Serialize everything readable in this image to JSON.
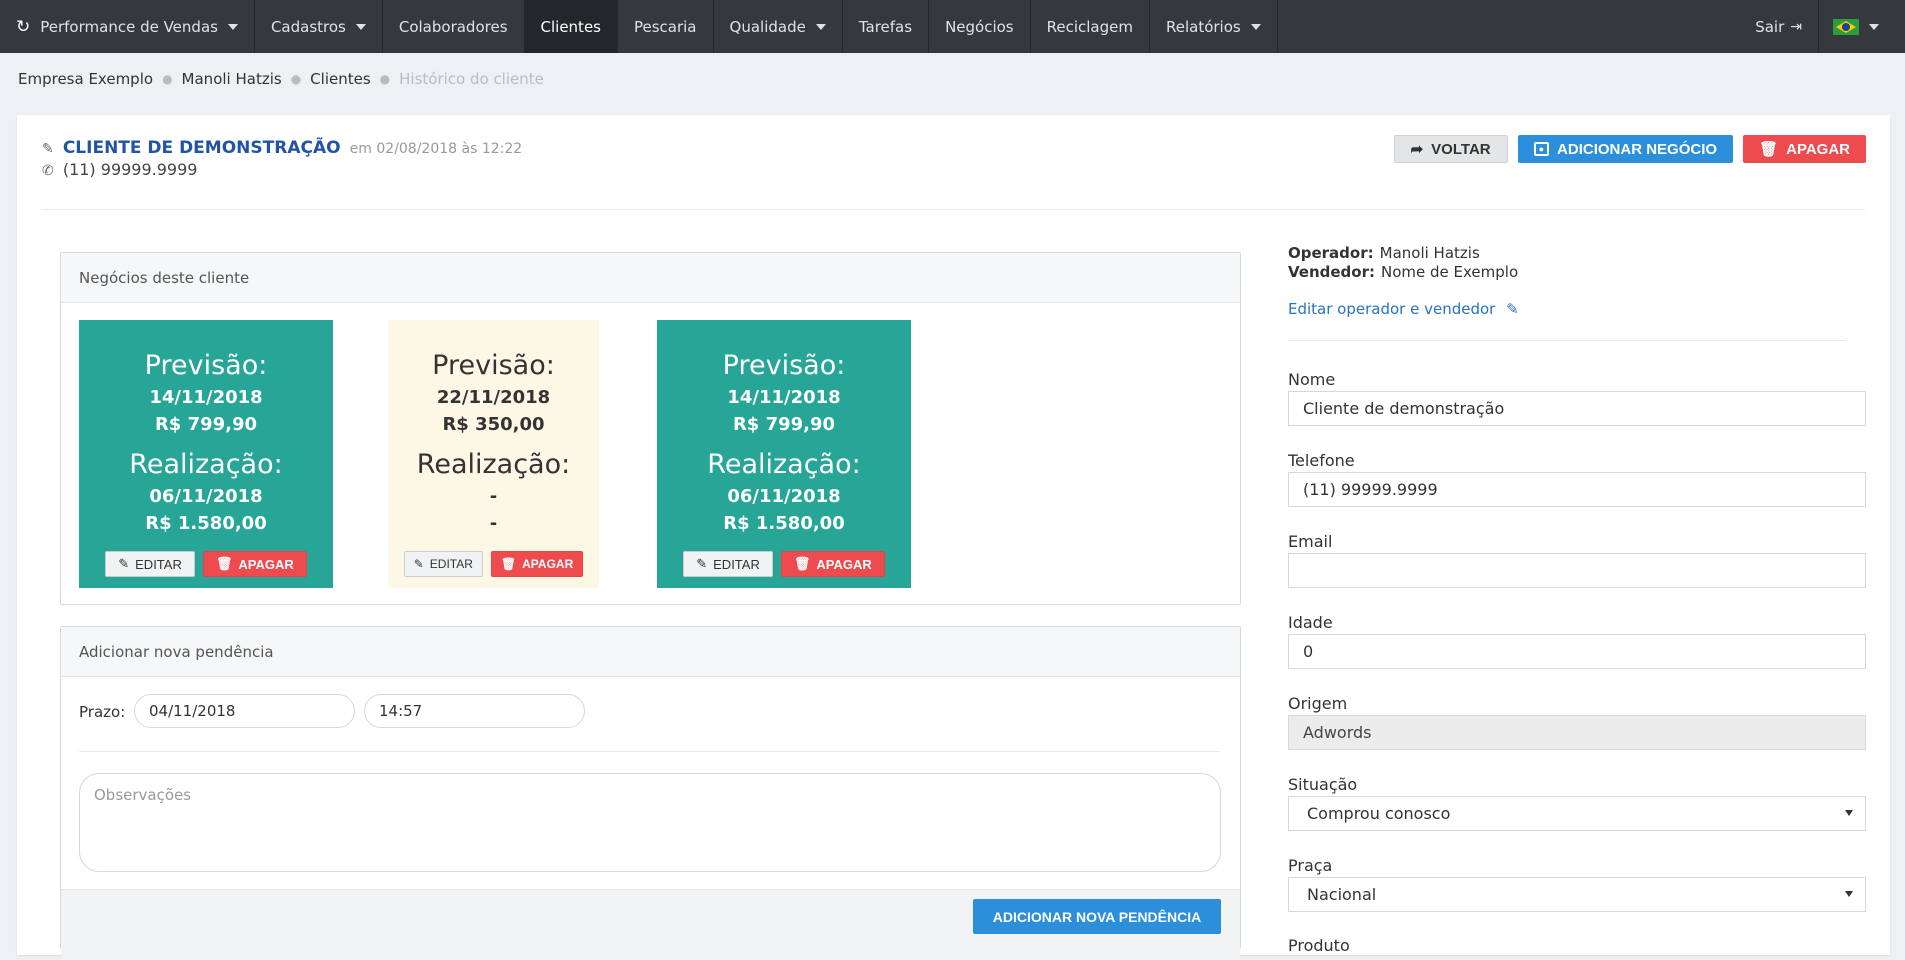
{
  "navbar": {
    "brand": "Performance de Vendas",
    "items": [
      "Cadastros",
      "Colaboradores",
      "Clientes",
      "Pescaria",
      "Qualidade",
      "Tarefas",
      "Negócios",
      "Reciclagem",
      "Relatórios"
    ],
    "active": "Clientes",
    "logout": "Sair"
  },
  "breadcrumb": [
    "Empresa Exemplo",
    "Manoli Hatzis",
    "Clientes",
    "Histórico do cliente"
  ],
  "client": {
    "title": "CLIENTE DE DEMONSTRAÇÃO",
    "date": "em 02/08/2018 às 12:22",
    "phone": "(11) 99999.9999"
  },
  "actions": {
    "back": "VOLTAR",
    "add_deal": "ADICIONAR NEGÓCIO",
    "delete": "APAGAR"
  },
  "deals_panel": {
    "title": "Negócios deste cliente",
    "forecast_label": "Previsão:",
    "done_label": "Realização:",
    "edit_label": "EDITAR",
    "delete_label": "APAGAR",
    "deals": [
      {
        "forecast_date": "14/11/2018",
        "forecast_value": "R$ 799,90",
        "done_date": "06/11/2018",
        "done_value": "R$ 1.580,00",
        "status_color": "#27a596"
      },
      {
        "forecast_date": "22/11/2018",
        "forecast_value": "R$ 350,00",
        "done_date": "-",
        "done_value": "-",
        "status_color": "#fdf8e6"
      },
      {
        "forecast_date": "14/11/2018",
        "forecast_value": "R$ 799,90",
        "done_date": "06/11/2018",
        "done_value": "R$ 1.580,00",
        "status_color": "#27a596"
      }
    ]
  },
  "pending_panel": {
    "title": "Adicionar nova pendência",
    "deadline_label": "Prazo:",
    "date": "04/11/2018",
    "time": "14:57",
    "notes_placeholder": "Observações",
    "submit": "ADICIONAR NOVA PENDÊNCIA"
  },
  "sidebar": {
    "operator_label": "Operador:",
    "operator": "Manoli Hatzis",
    "seller_label": "Vendedor:",
    "seller": "Nome de Exemplo",
    "edit_link": "Editar operador e vendedor",
    "fields": {
      "name_label": "Nome",
      "name": "Cliente de demonstração",
      "phone_label": "Telefone",
      "phone": "(11) 99999.9999",
      "email_label": "Email",
      "email": "",
      "age_label": "Idade",
      "age": "0",
      "origin_label": "Origem",
      "origin": "Adwords",
      "status_label": "Situação",
      "status": "Comprou conosco",
      "square_label": "Praça",
      "square": "Nacional",
      "product_label": "Produto"
    }
  }
}
